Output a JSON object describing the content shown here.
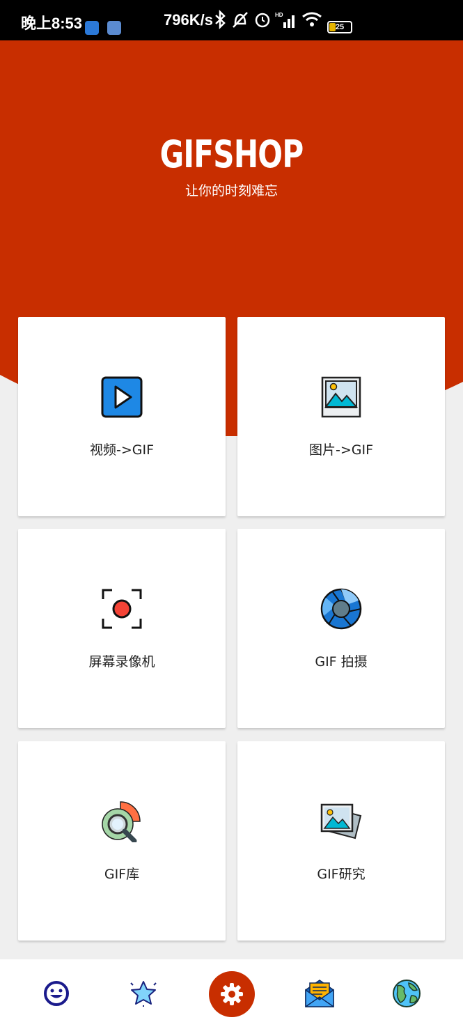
{
  "status_bar": {
    "time": "晚上8:53",
    "net_speed": "796K/s",
    "battery": "25"
  },
  "header": {
    "title": "GIFSHOP",
    "subtitle": "让你的时刻难忘"
  },
  "tiles": [
    {
      "label": "视频->GIF",
      "icon": "video-play-icon"
    },
    {
      "label": "图片->GIF",
      "icon": "image-icon"
    },
    {
      "label": "屏幕录像机",
      "icon": "screen-record-icon"
    },
    {
      "label": "GIF 拍摄",
      "icon": "camera-aperture-icon"
    },
    {
      "label": "GIF库",
      "icon": "library-search-icon"
    },
    {
      "label": "GIF研究",
      "icon": "photos-icon"
    }
  ],
  "bottom_nav": [
    {
      "icon": "smiley-icon"
    },
    {
      "icon": "star-icon"
    },
    {
      "icon": "settings-gear-icon"
    },
    {
      "icon": "mail-icon"
    },
    {
      "icon": "globe-icon"
    }
  ],
  "colors": {
    "header": "#c82e00",
    "background": "#efefef"
  }
}
